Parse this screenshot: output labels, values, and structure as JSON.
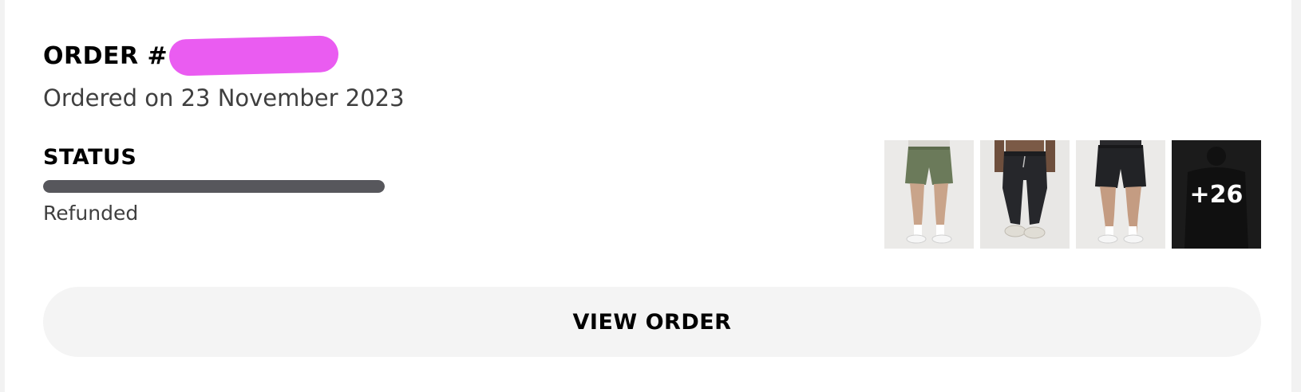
{
  "order": {
    "title_prefix": "ORDER #",
    "number_redacted": true,
    "ordered_on": "Ordered on 23 November 2023"
  },
  "status": {
    "label": "STATUS",
    "value": "Refunded",
    "progress_percent": 100
  },
  "items": {
    "thumbnails": [
      {
        "name": "green-shorts-image",
        "color": "#6b7a5a"
      },
      {
        "name": "black-joggers-image",
        "color": "#26272b"
      },
      {
        "name": "black-shorts-image",
        "color": "#222326"
      }
    ],
    "more_count": "+26"
  },
  "actions": {
    "view_order_label": "VIEW ORDER"
  },
  "colors": {
    "redaction": "#ea5cf1",
    "progress": "#57575c",
    "button_bg": "#f4f4f4"
  }
}
